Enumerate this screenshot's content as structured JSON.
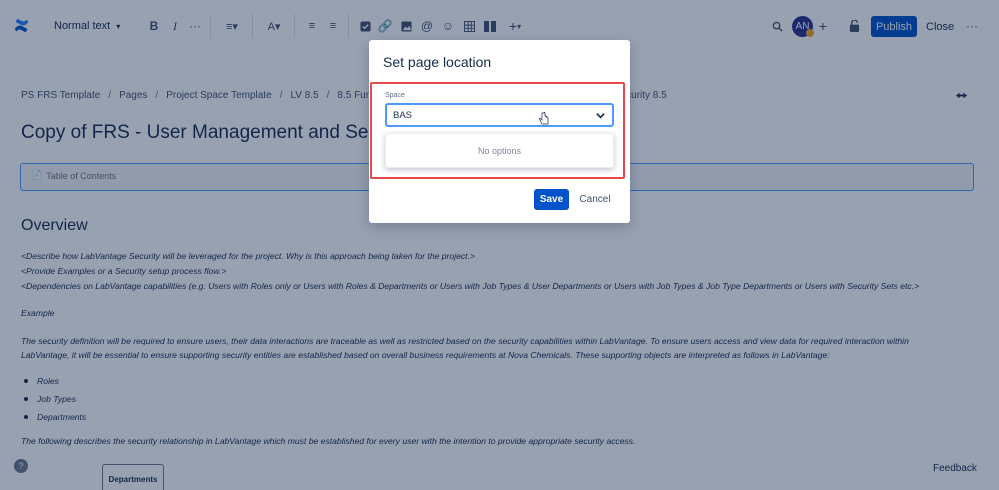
{
  "toolbar": {
    "text_style": "Normal text",
    "avatar_initials": "AN",
    "publish_label": "Publish",
    "close_label": "Close"
  },
  "breadcrumb": {
    "items": [
      "PS FRS Template",
      "Pages",
      "Project Space Template",
      "LV 8.5",
      "8.5 Functional Re"
    ],
    "trailing": "nd Security 8.5"
  },
  "page": {
    "title": "Copy of FRS - User Management and Secur",
    "toc_label": "Table of Contents",
    "overview_heading": "Overview",
    "lines": [
      "<Describe how LabVantage Security will be leveraged for the project. Why is this approach being taken for the project.>",
      "<Provide Examples or a Security setup process flow.>",
      "<Dependencies on LabVantage capabilities (e.g. Users with Roles only or Users with Roles & Departments or Users with Job Types & User Departments or Users with Job Types & Job Type Departments or Users with Security Sets etc.>",
      "Example",
      "The security definition will be required to ensure users, their data interactions are traceable as well as restricted based on the security capabilities within LabVantage. To ensure users access and view data for required interaction within",
      "LabVantage, it will be essential to ensure supporting security entities are established based on overall business requirements at Nova Chemicals. These supporting objects are interpreted as follows in LabVantage:"
    ],
    "bullets": [
      "Roles",
      "Job Types",
      "Departments"
    ],
    "closing_line": "The following describes the security relationship in LabVantage which must be established for every user with the intention to provide appropriate security access.",
    "dept_tab": "Departments",
    "help": "?",
    "feedback": "Feedback"
  },
  "dialog": {
    "title": "Set page location",
    "field_label": "Space",
    "field_value": "BAS",
    "no_options": "No options",
    "save_label": "Save",
    "cancel_label": "Cancel"
  },
  "colors": {
    "primary": "#0052cc",
    "focus": "#4c9aff",
    "highlight": "#e5484d",
    "overlay": "rgba(9,30,66,0.42)"
  }
}
